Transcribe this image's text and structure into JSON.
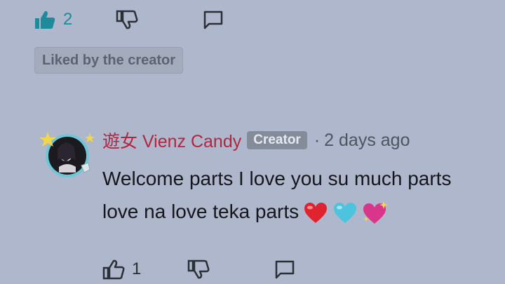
{
  "top_actions": {
    "like_count": "2"
  },
  "liked_badge": {
    "label": "Liked by the creator"
  },
  "comment": {
    "author": "遊女 Vienz Candy",
    "creator_badge": "Creator",
    "separator": "·",
    "timestamp": "2 days ago",
    "line1": "Welcome parts I love you su much parts",
    "line2": "love na love teka parts",
    "emojis": [
      "red-heart",
      "light-blue-heart",
      "sparkling-heart"
    ]
  },
  "bottom_actions": {
    "like_count": "1"
  },
  "colors": {
    "background": "#aeb7cb",
    "liked_accent": "#1f8a9a",
    "author": "#b3263f"
  }
}
